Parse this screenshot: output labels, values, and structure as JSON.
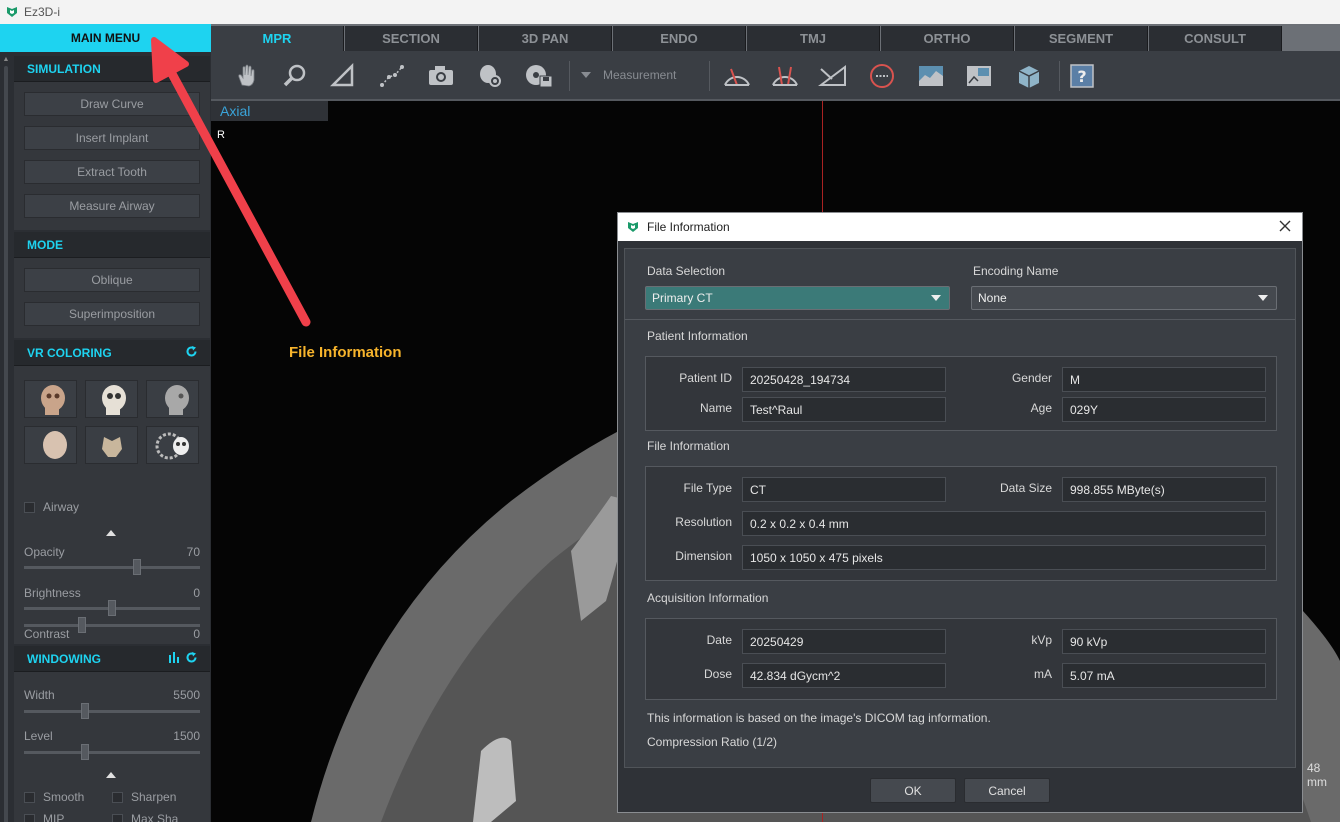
{
  "window": {
    "title": "Ez3D-i"
  },
  "sidebar": {
    "main_menu": "MAIN MENU",
    "simulation": {
      "title": "SIMULATION",
      "buttons": [
        "Draw Curve",
        "Insert Implant",
        "Extract Tooth",
        "Measure Airway"
      ]
    },
    "mode": {
      "title": "MODE",
      "buttons": [
        "Oblique",
        "Superimposition"
      ]
    },
    "vr_coloring": {
      "title": "VR COLORING",
      "airway_label": "Airway",
      "opacity": {
        "label": "Opacity",
        "value": "70",
        "fraction": 0.65
      },
      "brightness": {
        "label": "Brightness",
        "value": "0",
        "fraction": 0.5
      },
      "contrast": {
        "label": "Contrast",
        "value": "0",
        "fraction": 0.32
      }
    },
    "windowing": {
      "title": "WINDOWING",
      "width": {
        "label": "Width",
        "value": "5500",
        "fraction": 0.34
      },
      "level": {
        "label": "Level",
        "value": "1500",
        "fraction": 0.34
      },
      "smooth_label": "Smooth",
      "sharpen_label": "Sharpen",
      "mip_label": "MIP",
      "maxsha_label": "Max Sha"
    }
  },
  "tabs": [
    "MPR",
    "SECTION",
    "3D PAN",
    "ENDO",
    "TMJ",
    "ORTHO",
    "SEGMENT",
    "CONSULT"
  ],
  "toolbar": {
    "measurement_label": "Measurement"
  },
  "viewport": {
    "view_label": "Axial",
    "orientation": "R",
    "scale_label": "48 mm"
  },
  "annotation": {
    "text": "File Information"
  },
  "dialog": {
    "title": "File Information",
    "data_selection": {
      "label": "Data Selection",
      "value": "Primary CT"
    },
    "encoding_name": {
      "label": "Encoding Name",
      "value": "None"
    },
    "patient": {
      "heading": "Patient Information",
      "id_label": "Patient ID",
      "id_value": "20250428_194734",
      "name_label": "Name",
      "name_value": "Test^Raul",
      "gender_label": "Gender",
      "gender_value": "M",
      "age_label": "Age",
      "age_value": "029Y"
    },
    "file": {
      "heading": "File Information",
      "type_label": "File Type",
      "type_value": "CT",
      "size_label": "Data Size",
      "size_value": "998.855 MByte(s)",
      "resolution_label": "Resolution",
      "resolution_value": "0.2 x 0.2 x 0.4 mm",
      "dimension_label": "Dimension",
      "dimension_value": "1050 x 1050 x 475 pixels"
    },
    "acquisition": {
      "heading": "Acquisition Information",
      "date_label": "Date",
      "date_value": "20250429",
      "kvp_label": "kVp",
      "kvp_value": "90 kVp",
      "dose_label": "Dose",
      "dose_value": "42.834 dGycm^2",
      "ma_label": "mA",
      "ma_value": "5.07 mA"
    },
    "note": "This information is based on the image's DICOM tag information.",
    "compression": "Compression Ratio (1/2)",
    "ok_label": "OK",
    "cancel_label": "Cancel"
  },
  "colors": {
    "accent": "#1ed3f0",
    "annotation": "#f7b42c",
    "arrow": "#f0404a"
  }
}
